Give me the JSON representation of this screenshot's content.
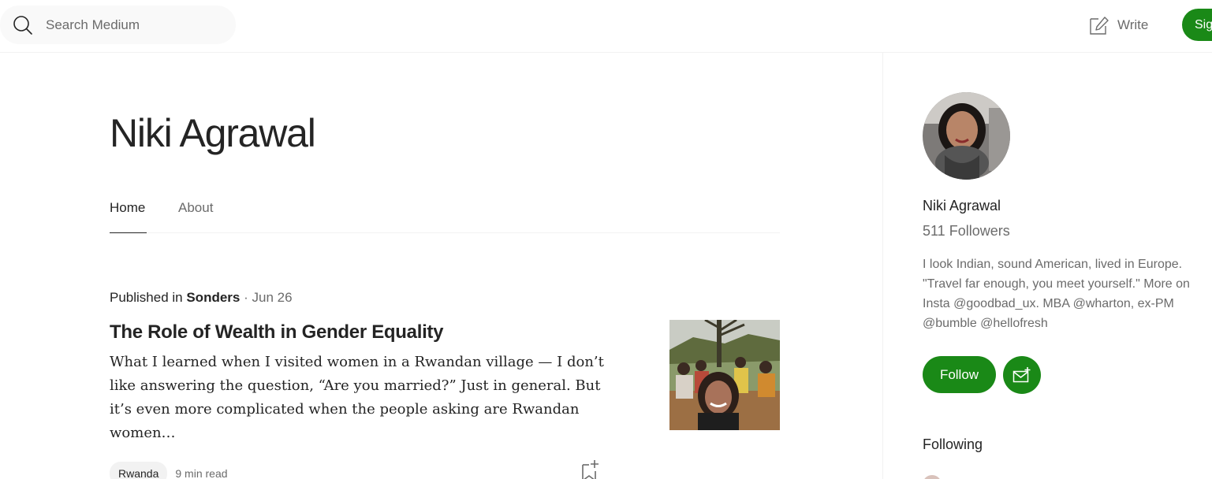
{
  "header": {
    "search_placeholder": "Search Medium",
    "write_label": "Write",
    "signup_label": "Sign up"
  },
  "profile": {
    "name": "Niki Agrawal",
    "tabs": [
      {
        "label": "Home",
        "active": true
      },
      {
        "label": "About",
        "active": false
      }
    ]
  },
  "article": {
    "published_prefix": "Published in ",
    "publication": "Sonders",
    "separator": " · ",
    "date": "Jun 26",
    "title": "The Role of Wealth in Gender Equality",
    "excerpt": "What I learned when I visited women in a Rwandan village — I don’t like answering the question, “Are you married?” Just in general. But it’s even more complicated when the people asking are Rwandan women…",
    "tag": "Rwanda",
    "read_time": "9 min read"
  },
  "sidebar": {
    "name": "Niki Agrawal",
    "followers": "511 Followers",
    "bio": "I look Indian, sound American, lived in Europe. \"Travel far enough, you meet yourself.\" More on Insta @goodbad_ux. MBA @wharton, ex-PM @bumble @hellofresh",
    "follow_label": "Follow",
    "following_heading": "Following"
  },
  "colors": {
    "accent_green": "#1a8917",
    "text_primary": "#242424",
    "text_secondary": "#6b6b6b",
    "divider": "#f2f2f2"
  },
  "icons": [
    "search-icon",
    "write-icon",
    "bookmark-add-icon",
    "subscribe-mail-icon"
  ]
}
